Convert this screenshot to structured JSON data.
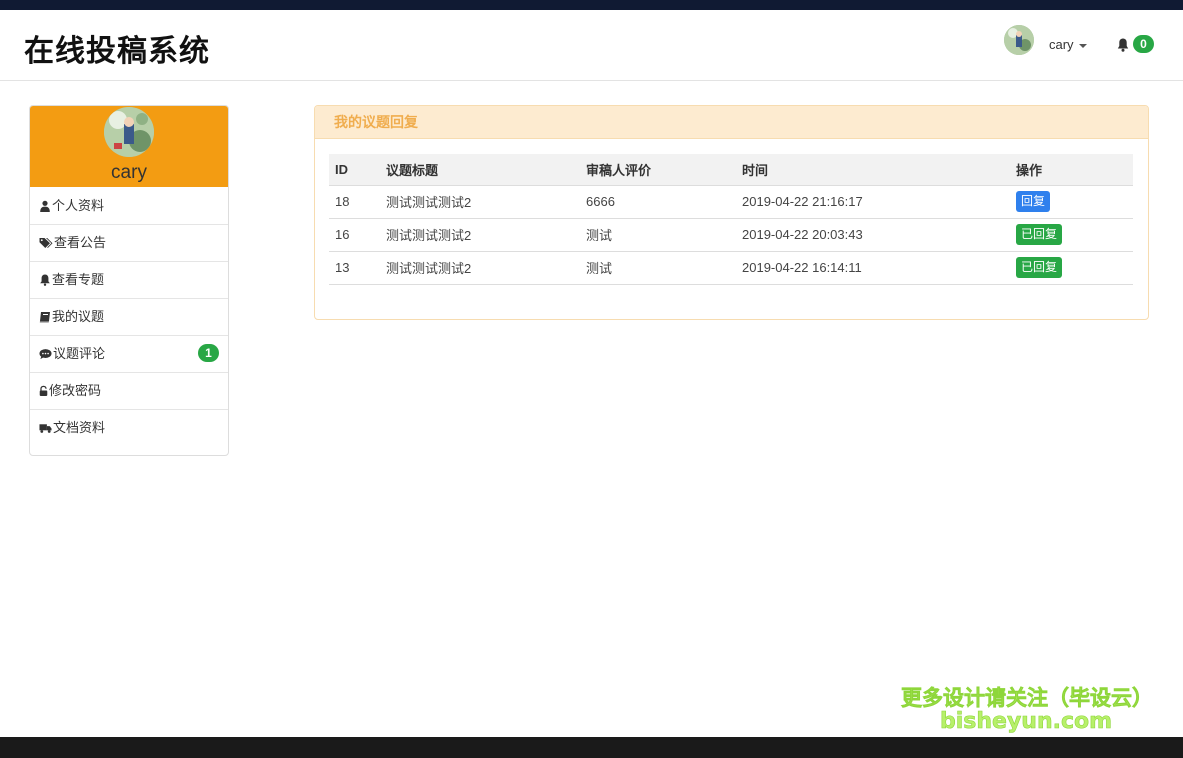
{
  "navbar": {
    "brand": "在线投稿系统",
    "username": "cary",
    "notification_count": "0"
  },
  "sidebar": {
    "username": "cary",
    "items": [
      {
        "label": "个人资料",
        "icon": "user-icon"
      },
      {
        "label": "查看公告",
        "icon": "tags-icon"
      },
      {
        "label": "查看专题",
        "icon": "bell-icon"
      },
      {
        "label": "我的议题",
        "icon": "book-icon"
      },
      {
        "label": "议题评论",
        "icon": "comment-icon",
        "badge": "1"
      },
      {
        "label": "修改密码",
        "icon": "lock-icon"
      },
      {
        "label": "文档资料",
        "icon": "truck-icon"
      }
    ]
  },
  "panel": {
    "title": "我的议题回复",
    "columns": [
      "ID",
      "议题标题",
      "审稿人评价",
      "时间",
      "操作"
    ],
    "rows": [
      {
        "id": "18",
        "title": "测试测试测试2",
        "review": "6666",
        "time": "2019-04-22 21:16:17",
        "action": "回复",
        "action_color": "#2f80ed"
      },
      {
        "id": "16",
        "title": "测试测试测试2",
        "review": "测试",
        "time": "2019-04-22 20:03:43",
        "action": "已回复",
        "action_color": "#28a745"
      },
      {
        "id": "13",
        "title": "测试测试测试2",
        "review": "测试",
        "time": "2019-04-22 16:14:11",
        "action": "已回复",
        "action_color": "#28a745"
      }
    ]
  },
  "watermark": {
    "line1": "更多设计请关注（毕设云）",
    "line2": "bisheyun.com"
  },
  "colors": {
    "sidebar_header": "#f39c12",
    "panel_header": "#fdebd0",
    "badge": "#28a745"
  }
}
